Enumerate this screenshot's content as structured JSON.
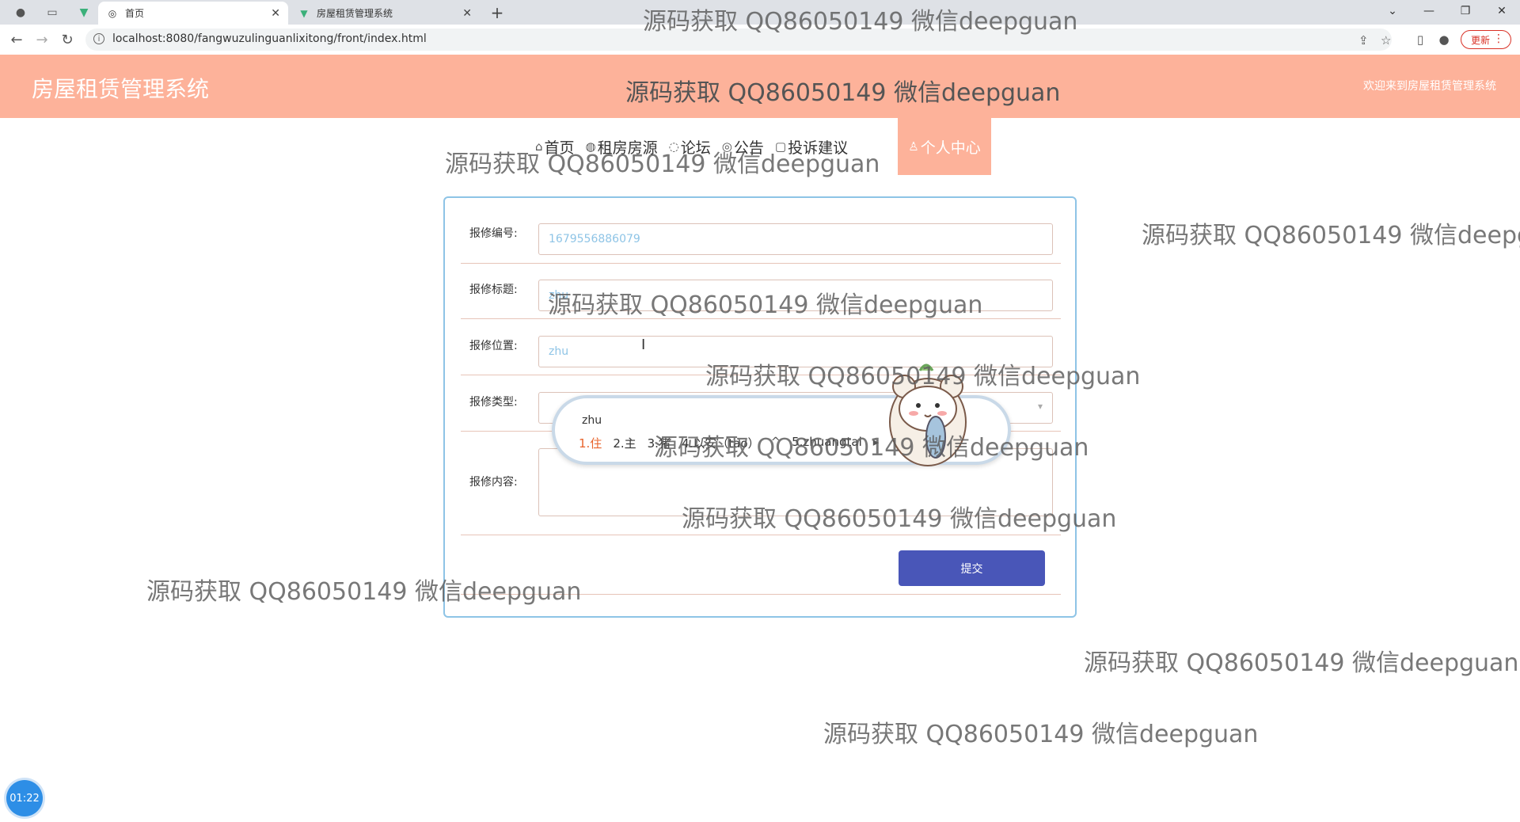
{
  "browser": {
    "tabs": [
      {
        "title": "首页",
        "active": true
      },
      {
        "title": "房屋租赁管理系统",
        "active": false
      }
    ],
    "url": "localhost:8080/fangwuzulinguanlixitong/front/index.html",
    "update_label": "更新"
  },
  "header": {
    "title": "房屋租赁管理系统",
    "welcome": "欢迎来到房屋租赁管理系统"
  },
  "nav": {
    "items": [
      {
        "label": "首页",
        "icon": "home-icon"
      },
      {
        "label": "租房房源",
        "icon": "globe-icon"
      },
      {
        "label": "论坛",
        "icon": "chat-icon"
      },
      {
        "label": "公告",
        "icon": "bell-icon"
      },
      {
        "label": "投诉建议",
        "icon": "doc-icon"
      }
    ],
    "active": {
      "label": "个人中心",
      "icon": "user-icon"
    }
  },
  "form": {
    "fields": [
      {
        "label": "报修编号:",
        "value": "1679556886079"
      },
      {
        "label": "报修标题:",
        "value": "zhu"
      },
      {
        "label": "报修位置:",
        "value": "zhu"
      },
      {
        "label": "报修类型:",
        "value": ""
      },
      {
        "label": "报修内容:",
        "value": ""
      }
    ],
    "submit_label": "提交"
  },
  "ime": {
    "composition": "zhu",
    "candidates": [
      "1.住",
      "2.主",
      "3.猪",
      "4.以安（tao）",
      "5.zhuangtai"
    ]
  },
  "watermark": "源码获取 QQ86050149 微信deepguan",
  "timer": "01:22",
  "colors": {
    "header_bg": "#fdb29a",
    "submit_bg": "#4956b8",
    "card_border": "#8ec4e6"
  }
}
